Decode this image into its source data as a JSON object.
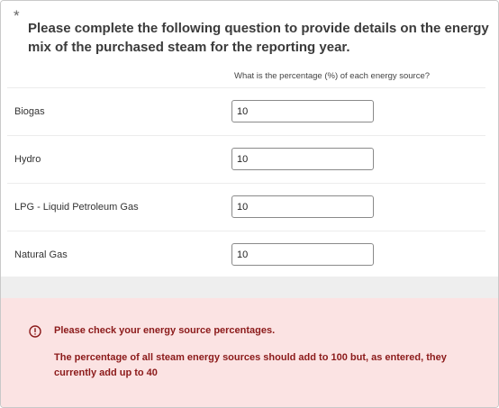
{
  "question": {
    "required_marker": "*",
    "text": "Please complete the following question to provide details on the energy mix of the purchased steam for the reporting year.",
    "column_header": "What is the percentage (%) of each energy source?"
  },
  "rows": [
    {
      "label": "Biogas",
      "value": "10"
    },
    {
      "label": "Hydro",
      "value": "10"
    },
    {
      "label": "LPG - Liquid Petroleum Gas",
      "value": "10"
    },
    {
      "label": "Natural Gas",
      "value": "10"
    }
  ],
  "error": {
    "icon": "exclamation-circle-icon",
    "title": "Please check your energy source percentages.",
    "message": "The percentage of all steam energy sources should add to 100 but, as entered, they currently add up to 40",
    "color": "#8b1a1a",
    "background": "#fbe3e3"
  }
}
